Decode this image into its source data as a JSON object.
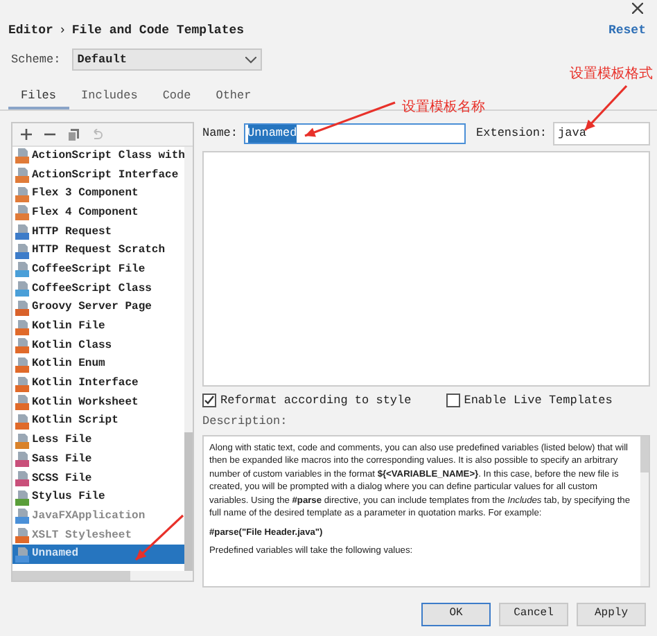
{
  "breadcrumb": {
    "parent": "Editor",
    "separator": "›",
    "title": "File and Code Templates"
  },
  "reset": "Reset",
  "scheme": {
    "label": "Scheme:",
    "value": "Default"
  },
  "tabs": [
    {
      "label": "Files",
      "selected": true
    },
    {
      "label": "Includes",
      "selected": false
    },
    {
      "label": "Code",
      "selected": false
    },
    {
      "label": "Other",
      "selected": false
    }
  ],
  "templates": [
    {
      "name": "ActionScript Class with",
      "color": "#e07b39",
      "disabled": false,
      "selected": false
    },
    {
      "name": "ActionScript Interface",
      "color": "#e07b39",
      "disabled": false,
      "selected": false
    },
    {
      "name": "Flex 3 Component",
      "color": "#e07b39",
      "disabled": false,
      "selected": false
    },
    {
      "name": "Flex 4 Component",
      "color": "#e07b39",
      "disabled": false,
      "selected": false
    },
    {
      "name": "HTTP Request",
      "color": "#3d7cc9",
      "disabled": false,
      "selected": false
    },
    {
      "name": "HTTP Request Scratch",
      "color": "#3d7cc9",
      "disabled": false,
      "selected": false
    },
    {
      "name": "CoffeeScript File",
      "color": "#4a9fd8",
      "disabled": false,
      "selected": false
    },
    {
      "name": "CoffeeScript Class",
      "color": "#4a9fd8",
      "disabled": false,
      "selected": false
    },
    {
      "name": "Groovy Server Page",
      "color": "#d9622b",
      "disabled": false,
      "selected": false
    },
    {
      "name": "Kotlin File",
      "color": "#e06a2a",
      "disabled": false,
      "selected": false
    },
    {
      "name": "Kotlin Class",
      "color": "#e06a2a",
      "disabled": false,
      "selected": false
    },
    {
      "name": "Kotlin Enum",
      "color": "#e06a2a",
      "disabled": false,
      "selected": false
    },
    {
      "name": "Kotlin Interface",
      "color": "#e06a2a",
      "disabled": false,
      "selected": false
    },
    {
      "name": "Kotlin Worksheet",
      "color": "#e06a2a",
      "disabled": false,
      "selected": false
    },
    {
      "name": "Kotlin Script",
      "color": "#e06a2a",
      "disabled": false,
      "selected": false
    },
    {
      "name": "Less File",
      "color": "#d9822b",
      "disabled": false,
      "selected": false
    },
    {
      "name": "Sass File",
      "color": "#c9507a",
      "disabled": false,
      "selected": false
    },
    {
      "name": "SCSS File",
      "color": "#c9507a",
      "disabled": false,
      "selected": false
    },
    {
      "name": "Stylus File",
      "color": "#5a9e3a",
      "disabled": false,
      "selected": false
    },
    {
      "name": "JavaFXApplication",
      "color": "#4a90d8",
      "disabled": true,
      "selected": false
    },
    {
      "name": "XSLT Stylesheet",
      "color": "#e06a2a",
      "disabled": true,
      "selected": false
    },
    {
      "name": "Unnamed",
      "color": "#4a90d8",
      "disabled": false,
      "selected": true
    }
  ],
  "name_field": {
    "label": "Name:",
    "value": "Unnamed"
  },
  "extension_field": {
    "label": "Extension:",
    "value": "java"
  },
  "reformat": {
    "label": "Reformat according to style",
    "checked": true
  },
  "live_templates": {
    "label": "Enable Live Templates",
    "checked": false
  },
  "description": {
    "label": "Description:",
    "paragraphs": [
      "Along with static text, code and comments, you can also use predefined variables (listed below) that will then be expanded like macros into the corresponding values. It is also possible to specify an arbitrary number of custom variables in the format **${<VARIABLE_NAME>}**. In this case, before the new file is created, you will be prompted with a dialog where you can define particular values for all custom variables. Using the **#parse** directive, you can include templates from the *Includes* tab, by specifying the full name of the desired template as a parameter in quotation marks. For example:",
      "**#parse(\"File Header.java\")**",
      "Predefined variables will take the following values:"
    ]
  },
  "buttons": [
    {
      "label": "OK",
      "default": true
    },
    {
      "label": "Cancel",
      "default": false
    },
    {
      "label": "Apply",
      "default": false
    }
  ],
  "callouts": [
    {
      "label": "设置模板名称"
    },
    {
      "label": "设置模板格式"
    }
  ]
}
